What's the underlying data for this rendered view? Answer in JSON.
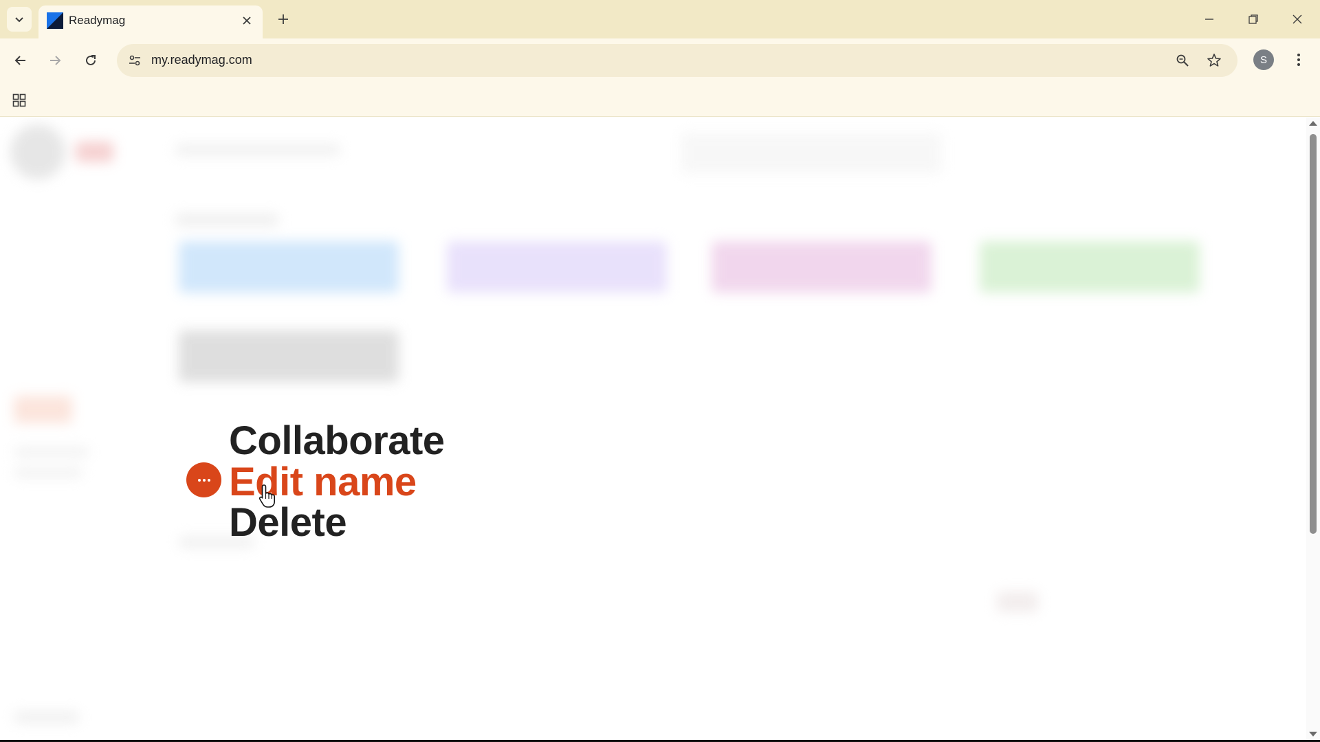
{
  "browser": {
    "tab": {
      "title": "Readymag"
    },
    "url": "my.readymag.com",
    "profile_initial": "S"
  },
  "icons": {
    "tab_list": "chevron-down-icon",
    "favicon": "readymag-logo-icon",
    "tab_close": "close-icon",
    "new_tab": "plus-icon",
    "minimize": "minimize-icon",
    "restore": "restore-icon",
    "close_window": "close-icon",
    "back": "arrow-left-icon",
    "forward": "arrow-right-icon",
    "reload": "reload-icon",
    "site_info": "tune-icon",
    "zoom": "zoom-icon",
    "bookmark": "star-icon",
    "menu": "more-vertical-icon",
    "apps": "grid-icon",
    "more_options": "more-horizontal-icon"
  },
  "context_menu": {
    "items": [
      {
        "label": "Collaborate",
        "highlighted": false
      },
      {
        "label": "Edit name",
        "highlighted": true
      },
      {
        "label": "Delete",
        "highlighted": false
      }
    ]
  },
  "colors": {
    "accent": "#d9461a",
    "tabstrip": "#f2e9c6",
    "toolbar": "#fdf8ea"
  }
}
